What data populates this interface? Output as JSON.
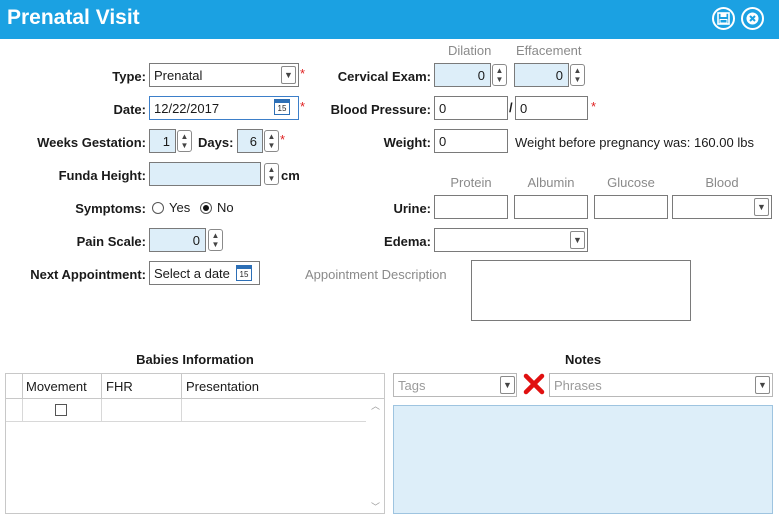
{
  "window": {
    "title": "Prenatal Visit",
    "save_icon": "save-icon",
    "close_icon": "close-icon"
  },
  "colors": {
    "accent": "#1ba1e2",
    "required": "#e02020",
    "numeric_bg": "#ddeef9",
    "notes_bg": "#ddeef9"
  },
  "form": {
    "type": {
      "label": "Type:",
      "value": "Prenatal",
      "required": "*"
    },
    "date": {
      "label": "Date:",
      "value": "12/22/2017",
      "required": "*",
      "calendar_day": "15"
    },
    "weeks": {
      "label": "Weeks Gestation:",
      "value": "1",
      "days_label": "Days:",
      "days_value": "6",
      "required": "*"
    },
    "funda": {
      "label": "Funda Height:",
      "value": "",
      "unit": "cm"
    },
    "symptoms": {
      "label": "Symptoms:",
      "yes": "Yes",
      "no": "No",
      "selected": "No"
    },
    "pain": {
      "label": "Pain Scale:",
      "value": "0"
    },
    "next_appt": {
      "label": "Next Appointment:",
      "placeholder": "Select a date",
      "calendar_day": "15"
    },
    "cervical": {
      "label": "Cervical Exam:",
      "dilation_header": "Dilation",
      "effacement_header": "Effacement",
      "dilation": "0",
      "effacement": "0"
    },
    "bp": {
      "label": "Blood Pressure:",
      "systolic": "0",
      "separator": "/",
      "diastolic": "0",
      "required": "*"
    },
    "weight": {
      "label": "Weight:",
      "value": "0",
      "note": "Weight before pregnancy was: 160.00 lbs"
    },
    "urine": {
      "label": "Urine:",
      "headers": [
        "Protein",
        "Albumin",
        "Glucose",
        "Blood"
      ]
    },
    "edema": {
      "label": "Edema:",
      "value": ""
    },
    "appt_desc": {
      "label": "Appointment Description",
      "value": ""
    }
  },
  "babies": {
    "title": "Babies Information",
    "columns": [
      "Movement",
      "FHR",
      "Presentation"
    ]
  },
  "notes": {
    "title": "Notes",
    "tags_placeholder": "Tags",
    "phrases_placeholder": "Phrases"
  }
}
